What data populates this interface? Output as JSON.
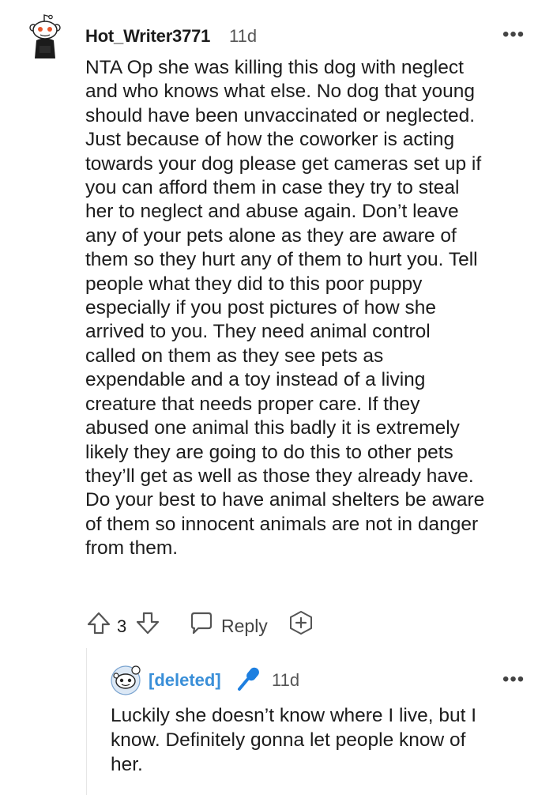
{
  "comment": {
    "username": "Hot_Writer3771",
    "age": "11d",
    "more": "•••",
    "body": "NTA Op she was killing this dog with neglect\nand who knows what else. No dog that young\nshould have been unvaccinated or neglected.\nJust because of how the coworker is acting\ntowards your dog please get cameras set up if\nyou can afford them in case they try to steal\nher to neglect and abuse again. Don’t leave\nany of your pets alone as they are aware of\nthem so they hurt any of them to hurt you. Tell\npeople what they did to this poor puppy\nespecially if you post pictures of how she\narrived to you. They need animal control\ncalled on them as they see pets as\nexpendable and a toy instead of a living\ncreature that needs proper care. If they\nabused one animal this badly it is extremely\nlikely they are going to do this to other pets\nthey’ll get as well as those they already have.\nDo your best to have animal shelters be aware\nof them so innocent animals are not in danger\nfrom them.",
    "score": "3",
    "reply_label": "Reply"
  },
  "reply": {
    "username": "[deleted]",
    "age": "11d",
    "more": "•••",
    "body": "Luckily she doesn’t know where I live, but I\nknow. Definitely gonna let people know of\nher."
  },
  "icons": [
    "snoo-avatar-icon",
    "upvote-icon",
    "downvote-icon",
    "reply-bubble-icon",
    "award-plus-icon",
    "deleted-avatar-icon",
    "microphone-icon"
  ],
  "colors": {
    "deleted_user": "#3a8fd8",
    "mic": "#1d7fe0",
    "avatar_red": "#e8562a"
  }
}
